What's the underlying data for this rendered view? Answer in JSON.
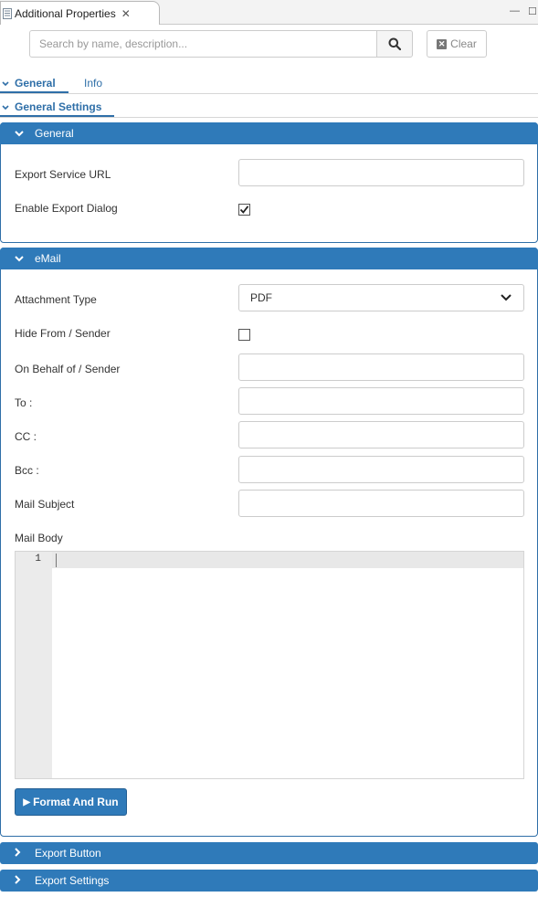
{
  "view": {
    "title": "Additional Properties",
    "close_glyph": "✕",
    "minimize_glyph": "—",
    "maximize_glyph": "☐"
  },
  "search": {
    "placeholder": "Search by name, description...",
    "value": "",
    "search_icon": "search-icon",
    "clear_label": "Clear",
    "clear_glyph": "✕"
  },
  "tabs": [
    {
      "label": "General",
      "active": true
    },
    {
      "label": "Info",
      "active": false
    }
  ],
  "subtab": {
    "label": "General Settings"
  },
  "sections": {
    "general": {
      "title": "General",
      "export_service_url_label": "Export Service URL",
      "export_service_url_value": "",
      "enable_export_dialog_label": "Enable Export Dialog",
      "enable_export_dialog_checked": true
    },
    "email": {
      "title": "eMail",
      "attachment_type_label": "Attachment Type",
      "attachment_type_value": "PDF",
      "hide_from_label": "Hide From / Sender",
      "hide_from_checked": false,
      "on_behalf_label": "On Behalf of / Sender",
      "to_label": "To :",
      "cc_label": "CC :",
      "bcc_label": "Bcc :",
      "mail_subject_label": "Mail Subject",
      "mail_body_label": "Mail Body",
      "editor_line_number": "1",
      "run_button_label": "Format And Run",
      "run_button_glyph": "▶"
    },
    "export_button": {
      "title": "Export Button",
      "collapsed": true
    },
    "export_settings": {
      "title": "Export Settings",
      "collapsed": true
    }
  },
  "colors": {
    "accent": "#2f7ab9",
    "tab_text": "#2f6fa8"
  }
}
